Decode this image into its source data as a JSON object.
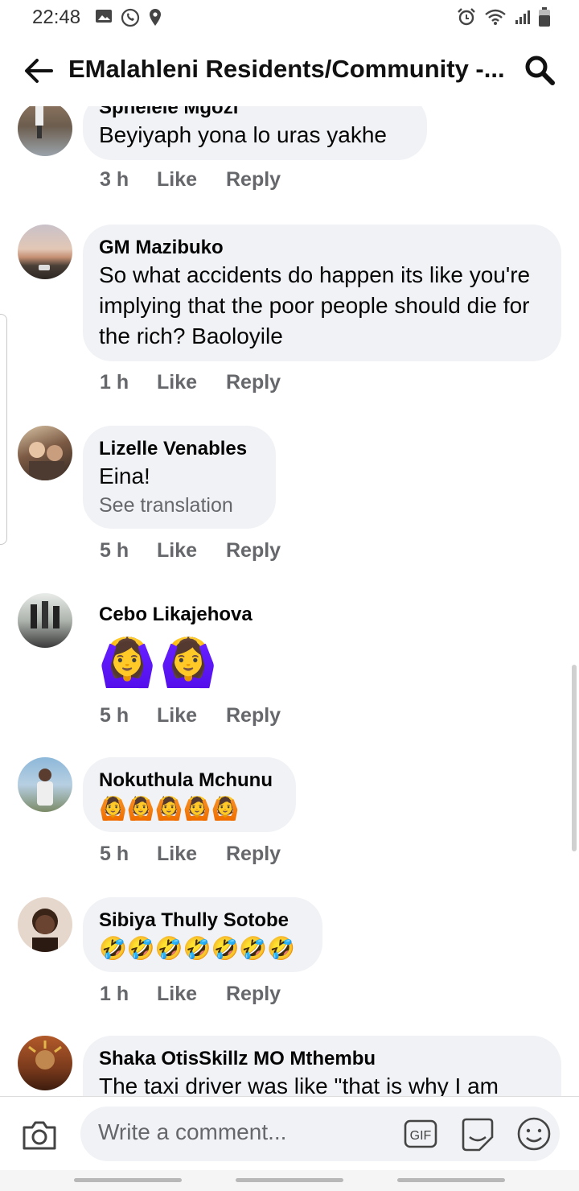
{
  "status_bar": {
    "time": "22:48",
    "left_icons": [
      "gallery-icon",
      "whatsapp-icon",
      "location-icon"
    ],
    "right_icons": [
      "alarm-icon",
      "wifi-icon",
      "signal-icon",
      "battery-icon"
    ]
  },
  "header": {
    "back_icon": "arrow-left-icon",
    "title": "EMalahleni Residents/Community -...",
    "search_icon": "search-icon"
  },
  "comments": [
    {
      "author": "Sphelele Mgozi",
      "text": "Beyiyaph yona lo uras yakhe",
      "time": "3 h",
      "like": "Like",
      "reply": "Reply"
    },
    {
      "author": "GM Mazibuko",
      "text": "So what accidents do happen its like you're implying that the poor people should die for the rich? Baoloyile",
      "time": "1 h",
      "like": "Like",
      "reply": "Reply"
    },
    {
      "author": "Lizelle Venables",
      "text": "Eina!",
      "see_translation": "See translation",
      "time": "5 h",
      "like": "Like",
      "reply": "Reply"
    },
    {
      "author": "Cebo Likajehova",
      "emoji": "🙆‍♀️🙆‍♀️",
      "time": "5 h",
      "like": "Like",
      "reply": "Reply"
    },
    {
      "author": "Nokuthula Mchunu",
      "emoji": "🙆🙆🙆🙆🙆",
      "time": "5 h",
      "like": "Like",
      "reply": "Reply"
    },
    {
      "author": "Sibiya Thully Sotobe",
      "emoji": "🤣🤣🤣🤣🤣🤣🤣",
      "time": "1 h",
      "like": "Like",
      "reply": "Reply"
    },
    {
      "author": "Shaka OtisSkillz MO Mthembu",
      "text": "The taxi driver was like \"that is why I am"
    }
  ],
  "composer": {
    "placeholder": "Write a comment...",
    "camera_icon": "camera-icon",
    "gif_icon": "gif-icon",
    "sticker_icon": "sticker-icon",
    "emoji_icon": "smiley-icon"
  },
  "colors": {
    "bubble": "#f0f2f5",
    "secondary_text": "#65676b",
    "primary_text": "#050505"
  }
}
